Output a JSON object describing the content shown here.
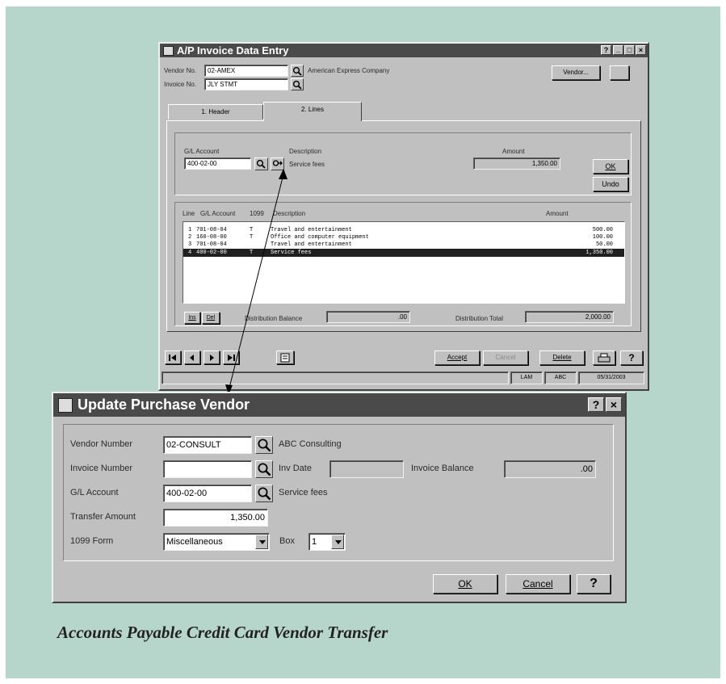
{
  "caption": "Accounts Payable Credit Card Vendor Transfer",
  "invoice_window": {
    "title": "A/P Invoice Data Entry",
    "title_buttons": [
      "?",
      "_",
      "□",
      "×"
    ],
    "vendor_no_label": "Vendor No.",
    "vendor_no_value": "02-AMEX",
    "vendor_name": "American Express Company",
    "invoice_no_label": "Invoice No.",
    "invoice_no_value": "JLY STMT",
    "vendor_button": "Vendor...",
    "tabs": [
      "1. Header",
      "2. Lines"
    ],
    "gl_account_label": "G/L Account",
    "gl_account_value": "400-02-00",
    "description_label": "Description",
    "description_value": "Service fees",
    "amount_label": "Amount",
    "amount_value": "1,350.00",
    "ok_button": "OK",
    "undo_button": "Undo",
    "grid_headers": {
      "line": "Line",
      "gl_account": "G/L Account",
      "tax": "1099",
      "description": "Description",
      "amount": "Amount"
    },
    "lines": [
      {
        "line": "1",
        "gl": "701-08-04",
        "tax": "T",
        "desc": "Travel and entertainment",
        "amount": "500.00"
      },
      {
        "line": "2",
        "gl": "160-08-00",
        "tax": "T",
        "desc": "Office and computer equipment",
        "amount": "100.00"
      },
      {
        "line": "3",
        "gl": "701-08-04",
        "tax": "",
        "desc": "Travel and entertainment",
        "amount": "50.00"
      },
      {
        "line": "4",
        "gl": "400-02-00",
        "tax": "T",
        "desc": "Service fees",
        "amount": "1,350.00"
      }
    ],
    "ins_button": "Ins",
    "del_button": "Del",
    "distribution_balance_label": "Distribution Balance",
    "distribution_balance_value": ".00",
    "distribution_total_label": "Distribution Total",
    "distribution_total_value": "2,000.00",
    "accept_button": "Accept",
    "cancel_button": "Cancel",
    "delete_button": "Delete",
    "help_button": "?",
    "status_user": "LAM",
    "status_company": "ABC",
    "status_date": "05/31/2003"
  },
  "update_window": {
    "title": "Update Purchase Vendor",
    "title_buttons": [
      "?",
      "×"
    ],
    "vendor_number_label": "Vendor Number",
    "vendor_number_value": "02-CONSULT",
    "vendor_name": "ABC Consulting",
    "invoice_number_label": "Invoice Number",
    "invoice_number_value": "",
    "inv_date_label": "Inv Date",
    "inv_date_value": "",
    "invoice_balance_label": "Invoice Balance",
    "invoice_balance_value": ".00",
    "gl_account_label": "G/L Account",
    "gl_account_value": "400-02-00",
    "gl_description": "Service fees",
    "transfer_amount_label": "Transfer Amount",
    "transfer_amount_value": "1,350.00",
    "form_1099_label": "1099 Form",
    "form_1099_value": "Miscellaneous",
    "box_label": "Box",
    "box_value": "1",
    "ok_button": "OK",
    "cancel_button": "Cancel",
    "help_button": "?"
  }
}
